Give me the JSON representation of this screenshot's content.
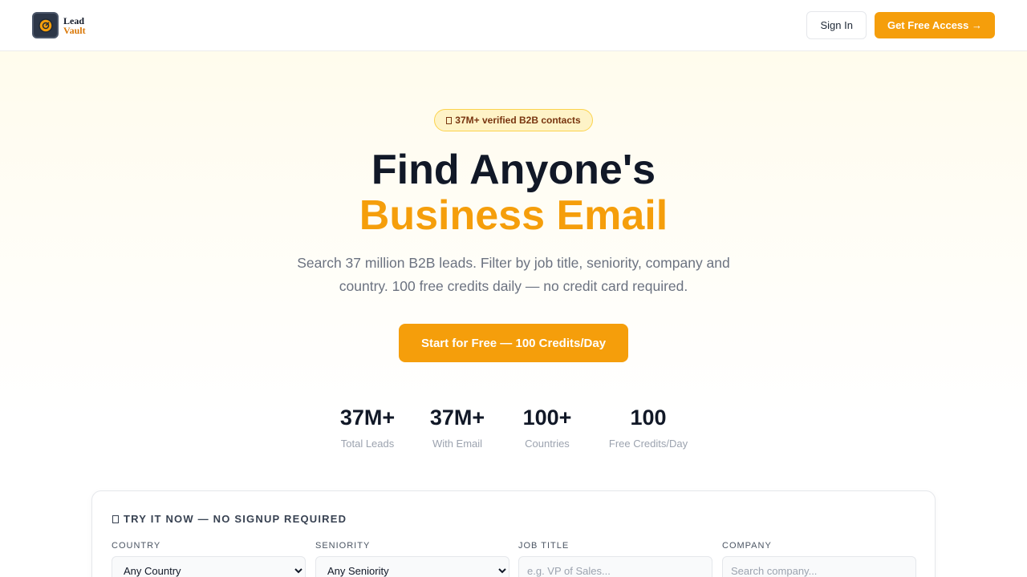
{
  "nav": {
    "logo": {
      "line1": "Lead",
      "line2": "Vault",
      "icon": "vault-icon"
    },
    "signin_label": "Sign In",
    "access_label": "Get Free Access →"
  },
  "hero": {
    "badge": "37M+ verified B2B contacts",
    "title_line1": "Find Anyone's",
    "title_line2": "Business Email",
    "subtitle": "Search 37 million B2B leads. Filter by job title, seniority, company and country. 100 free credits daily — no credit card required.",
    "cta_label": "Start for Free — 100 Credits/Day"
  },
  "stats": [
    {
      "value": "37M+",
      "label": "Total Leads"
    },
    {
      "value": "37M+",
      "label": "With Email"
    },
    {
      "value": "100+",
      "label": "Countries"
    },
    {
      "value": "100",
      "label": "Free Credits/Day"
    }
  ],
  "search": {
    "title": "TRY IT NOW — NO SIGNUP REQUIRED",
    "country": {
      "label": "COUNTRY",
      "selected": "Any Country"
    },
    "seniority": {
      "label": "SENIORITY",
      "selected": "Any Seniority"
    },
    "job_title": {
      "label": "JOB TITLE",
      "placeholder": "e.g. VP of Sales..."
    },
    "company": {
      "label": "COMPANY",
      "placeholder": "Search company..."
    }
  },
  "colors": {
    "accent": "#f59e0b",
    "heading": "#111827",
    "muted": "#6b7280"
  }
}
